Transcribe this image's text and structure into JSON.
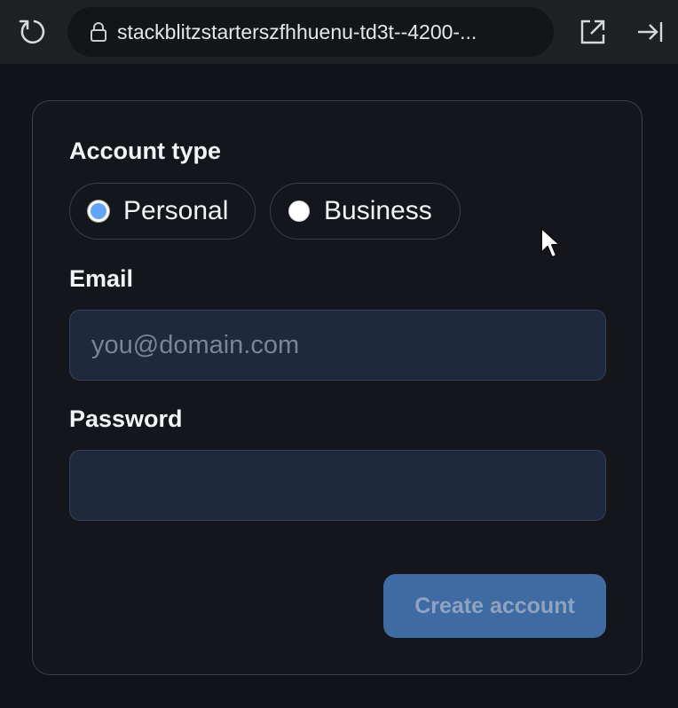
{
  "browser": {
    "url": "stackblitzstarterszfhhuenu-td3t--4200-...",
    "icons": {
      "reload": "reload-icon",
      "lock": "lock-icon",
      "open_external": "open-external-icon",
      "sidebar_toggle": "sidebar-toggle-icon"
    }
  },
  "form": {
    "account_type_label": "Account type",
    "account_types": [
      {
        "label": "Personal",
        "checked": true
      },
      {
        "label": "Business",
        "checked": false
      }
    ],
    "email_label": "Email",
    "email_placeholder": "you@domain.com",
    "email_value": "",
    "password_label": "Password",
    "password_value": "",
    "submit_label": "Create account",
    "submit_disabled": true
  },
  "colors": {
    "accent": "#60a5fa",
    "button": "#3f6ba3",
    "field_bg": "#1e293b",
    "card_border": "#3a3e46"
  }
}
